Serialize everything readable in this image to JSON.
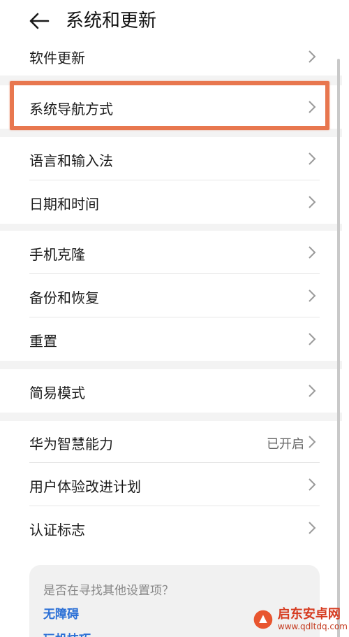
{
  "header": {
    "title": "系统和更新"
  },
  "rows": [
    {
      "label": "软件更新"
    },
    {
      "label": "系统导航方式"
    },
    {
      "label": "语言和输入法"
    },
    {
      "label": "日期和时间"
    },
    {
      "label": "手机克隆"
    },
    {
      "label": "备份和恢复"
    },
    {
      "label": "重置"
    },
    {
      "label": "简易模式"
    },
    {
      "label": "华为智慧能力",
      "value": "已开启"
    },
    {
      "label": "用户体验改进计划"
    },
    {
      "label": "认证标志"
    }
  ],
  "help_card": {
    "title": "是否在寻找其他设置项？",
    "links": [
      "无障碍",
      "玩机技巧"
    ]
  },
  "watermark": {
    "name": "启东安卓网",
    "url": "www.qdltdq.com"
  },
  "colors": {
    "highlight": "#e8774f",
    "link": "#2a6fd6"
  }
}
